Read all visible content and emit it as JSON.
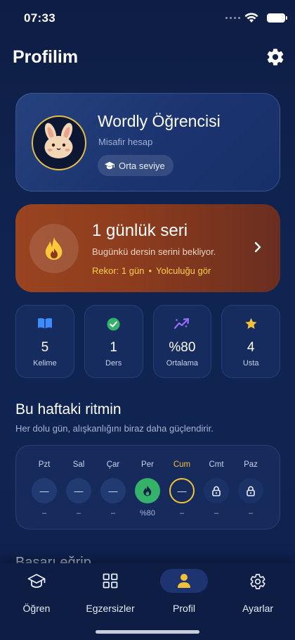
{
  "status_bar": {
    "time": "07:33"
  },
  "header": {
    "title": "Profilim",
    "settings_icon": "gear-icon"
  },
  "profile": {
    "name": "Wordly Öğrencisi",
    "subtitle": "Misafir hesap",
    "level": "Orta seviye",
    "avatar_icon": "bunny-avatar-icon",
    "accent": "#e4c04a"
  },
  "streak": {
    "title": "1 günlük seri",
    "subtitle": "Bugünkü dersin serini bekliyor.",
    "record": "Rekor: 1 gün",
    "separator": "•",
    "journey_link": "Yolculuğu gör",
    "icon": "flame-icon"
  },
  "stats": [
    {
      "icon": "book-icon",
      "value": "5",
      "label": "Kelime",
      "color": "#3d8bff"
    },
    {
      "icon": "check-icon",
      "value": "1",
      "label": "Ders",
      "color": "#34b26a"
    },
    {
      "icon": "trend-icon",
      "value": "%80",
      "label": "Ortalama",
      "color": "#9a6bff"
    },
    {
      "icon": "star-icon",
      "value": "4",
      "label": "Usta",
      "color": "#f1c13a"
    }
  ],
  "week": {
    "title": "Bu haftaki ritmin",
    "subtitle": "Her dolu gün, alışkanlığını biraz daha güçlendirir.",
    "days": [
      {
        "name": "Pzt",
        "mark": "—",
        "value": "–",
        "state": "empty"
      },
      {
        "name": "Sal",
        "mark": "—",
        "value": "–",
        "state": "empty"
      },
      {
        "name": "Çar",
        "mark": "—",
        "value": "–",
        "state": "empty"
      },
      {
        "name": "Per",
        "mark": "",
        "value": "%80",
        "state": "done"
      },
      {
        "name": "Cum",
        "mark": "—",
        "value": "–",
        "state": "today"
      },
      {
        "name": "Cmt",
        "mark": "",
        "value": "–",
        "state": "locked"
      },
      {
        "name": "Paz",
        "mark": "",
        "value": "–",
        "state": "locked"
      }
    ]
  },
  "next_section": {
    "title": "Başarı eğrip"
  },
  "tabs": [
    {
      "label": "Öğren",
      "icon": "graduation-cap-icon",
      "active": false
    },
    {
      "label": "Egzersizler",
      "icon": "grid-icon",
      "active": false
    },
    {
      "label": "Profil",
      "icon": "person-icon",
      "active": true
    },
    {
      "label": "Ayarlar",
      "icon": "gear-icon",
      "active": false
    }
  ],
  "colors": {
    "background": "#0f2350",
    "streak_orange": "#9a4420",
    "highlight_yellow": "#f1c13a",
    "success_green": "#34b26a"
  }
}
